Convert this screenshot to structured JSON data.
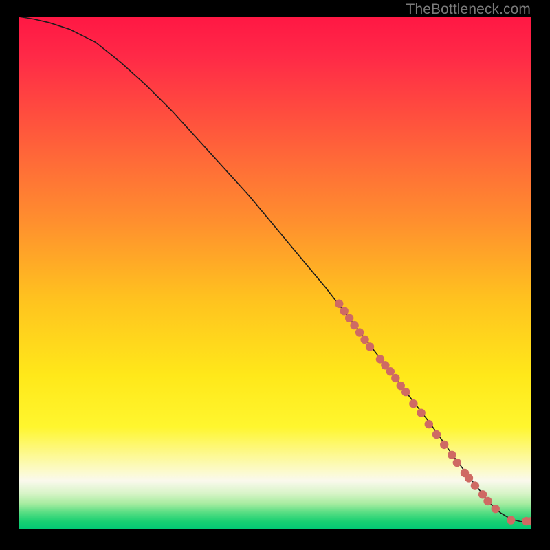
{
  "watermark": "TheBottleneck.com",
  "chart_data": {
    "type": "line",
    "title": "",
    "xlabel": "",
    "ylabel": "",
    "xlim": [
      0,
      100
    ],
    "ylim": [
      0,
      100
    ],
    "grid": false,
    "legend": false,
    "curve": {
      "x": [
        0,
        3,
        6,
        10,
        15,
        20,
        25,
        30,
        35,
        40,
        45,
        50,
        55,
        60,
        65,
        70,
        75,
        80,
        85,
        88,
        90,
        92,
        94,
        96,
        98,
        100
      ],
      "y": [
        100,
        99.5,
        98.8,
        97.5,
        95,
        91,
        86.5,
        81.5,
        76,
        70.5,
        65,
        59,
        53,
        47,
        40.5,
        34,
        27.5,
        21,
        14,
        10,
        7.5,
        5,
        3.2,
        2,
        1.5,
        1.5
      ]
    },
    "markers": [
      {
        "x": 62.5,
        "y": 44.0
      },
      {
        "x": 63.5,
        "y": 42.6
      },
      {
        "x": 64.5,
        "y": 41.2
      },
      {
        "x": 65.5,
        "y": 39.8
      },
      {
        "x": 66.5,
        "y": 38.4
      },
      {
        "x": 67.5,
        "y": 37.0
      },
      {
        "x": 68.5,
        "y": 35.6
      },
      {
        "x": 70.5,
        "y": 33.2
      },
      {
        "x": 71.5,
        "y": 32.0
      },
      {
        "x": 72.5,
        "y": 30.8
      },
      {
        "x": 73.5,
        "y": 29.5
      },
      {
        "x": 74.5,
        "y": 28.0
      },
      {
        "x": 75.5,
        "y": 26.8
      },
      {
        "x": 77.0,
        "y": 24.5
      },
      {
        "x": 78.5,
        "y": 22.7
      },
      {
        "x": 80.0,
        "y": 20.5
      },
      {
        "x": 81.5,
        "y": 18.5
      },
      {
        "x": 83.0,
        "y": 16.5
      },
      {
        "x": 84.5,
        "y": 14.5
      },
      {
        "x": 85.5,
        "y": 13.0
      },
      {
        "x": 87.0,
        "y": 11.0
      },
      {
        "x": 87.8,
        "y": 10.0
      },
      {
        "x": 89.0,
        "y": 8.5
      },
      {
        "x": 90.5,
        "y": 6.8
      },
      {
        "x": 91.5,
        "y": 5.5
      },
      {
        "x": 93.0,
        "y": 4.0
      },
      {
        "x": 96.0,
        "y": 1.8
      },
      {
        "x": 99.0,
        "y": 1.6
      },
      {
        "x": 100.0,
        "y": 1.6
      }
    ],
    "gradient_stops": [
      {
        "offset": 0.0,
        "color": "#ff1744"
      },
      {
        "offset": 0.08,
        "color": "#ff2a47"
      },
      {
        "offset": 0.18,
        "color": "#ff4a3f"
      },
      {
        "offset": 0.28,
        "color": "#ff6a38"
      },
      {
        "offset": 0.4,
        "color": "#ff8f2e"
      },
      {
        "offset": 0.55,
        "color": "#ffc21f"
      },
      {
        "offset": 0.7,
        "color": "#ffe81a"
      },
      {
        "offset": 0.8,
        "color": "#fff62e"
      },
      {
        "offset": 0.88,
        "color": "#fcfac0"
      },
      {
        "offset": 0.905,
        "color": "#faf9ed"
      },
      {
        "offset": 0.93,
        "color": "#d8f4c7"
      },
      {
        "offset": 0.95,
        "color": "#a6eca0"
      },
      {
        "offset": 0.968,
        "color": "#54dd82"
      },
      {
        "offset": 0.985,
        "color": "#18d072"
      },
      {
        "offset": 1.0,
        "color": "#00c874"
      }
    ],
    "marker_color": "#cf6a63",
    "line_color": "#1b1b1b"
  }
}
